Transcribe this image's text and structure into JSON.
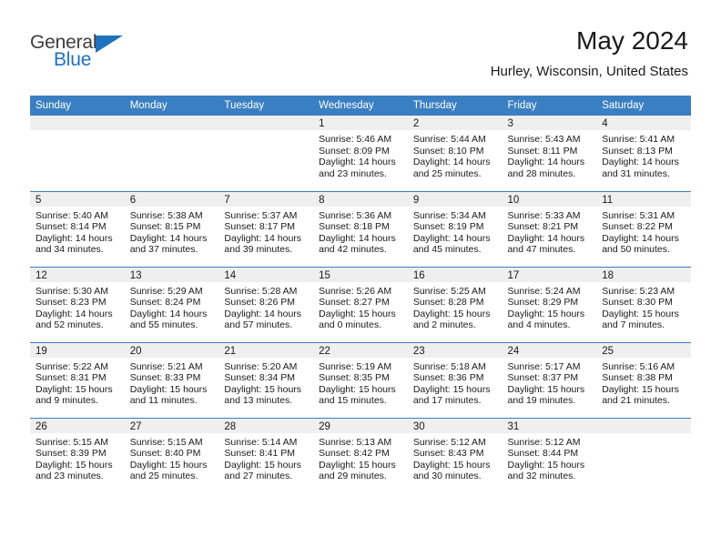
{
  "brand": {
    "name_primary": "General",
    "name_secondary": "Blue",
    "triangle_color": "#1f72bd"
  },
  "header": {
    "title": "May 2024",
    "subtitle": "Hurley, Wisconsin, United States"
  },
  "theme": {
    "header_bar_color": "#3a7fc1",
    "daynum_band_color": "#efefef",
    "row_divider_color": "#3a7fc1",
    "text_color": "#1a1a1a"
  },
  "labels": {
    "sunrise_prefix": "Sunrise:",
    "sunset_prefix": "Sunset:",
    "daylight_prefix": "Daylight:"
  },
  "weekday_headers": [
    "Sunday",
    "Monday",
    "Tuesday",
    "Wednesday",
    "Thursday",
    "Friday",
    "Saturday"
  ],
  "weeks": [
    [
      {
        "day": "",
        "empty": true,
        "line1": "",
        "line2": "",
        "line3": "",
        "line4": ""
      },
      {
        "day": "",
        "empty": true,
        "line1": "",
        "line2": "",
        "line3": "",
        "line4": ""
      },
      {
        "day": "",
        "empty": true,
        "line1": "",
        "line2": "",
        "line3": "",
        "line4": ""
      },
      {
        "day": "1",
        "empty": false,
        "line1": "Sunrise: 5:46 AM",
        "line2": "Sunset: 8:09 PM",
        "line3": "Daylight: 14 hours",
        "line4": "and 23 minutes."
      },
      {
        "day": "2",
        "empty": false,
        "line1": "Sunrise: 5:44 AM",
        "line2": "Sunset: 8:10 PM",
        "line3": "Daylight: 14 hours",
        "line4": "and 25 minutes."
      },
      {
        "day": "3",
        "empty": false,
        "line1": "Sunrise: 5:43 AM",
        "line2": "Sunset: 8:11 PM",
        "line3": "Daylight: 14 hours",
        "line4": "and 28 minutes."
      },
      {
        "day": "4",
        "empty": false,
        "line1": "Sunrise: 5:41 AM",
        "line2": "Sunset: 8:13 PM",
        "line3": "Daylight: 14 hours",
        "line4": "and 31 minutes."
      }
    ],
    [
      {
        "day": "5",
        "empty": false,
        "line1": "Sunrise: 5:40 AM",
        "line2": "Sunset: 8:14 PM",
        "line3": "Daylight: 14 hours",
        "line4": "and 34 minutes."
      },
      {
        "day": "6",
        "empty": false,
        "line1": "Sunrise: 5:38 AM",
        "line2": "Sunset: 8:15 PM",
        "line3": "Daylight: 14 hours",
        "line4": "and 37 minutes."
      },
      {
        "day": "7",
        "empty": false,
        "line1": "Sunrise: 5:37 AM",
        "line2": "Sunset: 8:17 PM",
        "line3": "Daylight: 14 hours",
        "line4": "and 39 minutes."
      },
      {
        "day": "8",
        "empty": false,
        "line1": "Sunrise: 5:36 AM",
        "line2": "Sunset: 8:18 PM",
        "line3": "Daylight: 14 hours",
        "line4": "and 42 minutes."
      },
      {
        "day": "9",
        "empty": false,
        "line1": "Sunrise: 5:34 AM",
        "line2": "Sunset: 8:19 PM",
        "line3": "Daylight: 14 hours",
        "line4": "and 45 minutes."
      },
      {
        "day": "10",
        "empty": false,
        "line1": "Sunrise: 5:33 AM",
        "line2": "Sunset: 8:21 PM",
        "line3": "Daylight: 14 hours",
        "line4": "and 47 minutes."
      },
      {
        "day": "11",
        "empty": false,
        "line1": "Sunrise: 5:31 AM",
        "line2": "Sunset: 8:22 PM",
        "line3": "Daylight: 14 hours",
        "line4": "and 50 minutes."
      }
    ],
    [
      {
        "day": "12",
        "empty": false,
        "line1": "Sunrise: 5:30 AM",
        "line2": "Sunset: 8:23 PM",
        "line3": "Daylight: 14 hours",
        "line4": "and 52 minutes."
      },
      {
        "day": "13",
        "empty": false,
        "line1": "Sunrise: 5:29 AM",
        "line2": "Sunset: 8:24 PM",
        "line3": "Daylight: 14 hours",
        "line4": "and 55 minutes."
      },
      {
        "day": "14",
        "empty": false,
        "line1": "Sunrise: 5:28 AM",
        "line2": "Sunset: 8:26 PM",
        "line3": "Daylight: 14 hours",
        "line4": "and 57 minutes."
      },
      {
        "day": "15",
        "empty": false,
        "line1": "Sunrise: 5:26 AM",
        "line2": "Sunset: 8:27 PM",
        "line3": "Daylight: 15 hours",
        "line4": "and 0 minutes."
      },
      {
        "day": "16",
        "empty": false,
        "line1": "Sunrise: 5:25 AM",
        "line2": "Sunset: 8:28 PM",
        "line3": "Daylight: 15 hours",
        "line4": "and 2 minutes."
      },
      {
        "day": "17",
        "empty": false,
        "line1": "Sunrise: 5:24 AM",
        "line2": "Sunset: 8:29 PM",
        "line3": "Daylight: 15 hours",
        "line4": "and 4 minutes."
      },
      {
        "day": "18",
        "empty": false,
        "line1": "Sunrise: 5:23 AM",
        "line2": "Sunset: 8:30 PM",
        "line3": "Daylight: 15 hours",
        "line4": "and 7 minutes."
      }
    ],
    [
      {
        "day": "19",
        "empty": false,
        "line1": "Sunrise: 5:22 AM",
        "line2": "Sunset: 8:31 PM",
        "line3": "Daylight: 15 hours",
        "line4": "and 9 minutes."
      },
      {
        "day": "20",
        "empty": false,
        "line1": "Sunrise: 5:21 AM",
        "line2": "Sunset: 8:33 PM",
        "line3": "Daylight: 15 hours",
        "line4": "and 11 minutes."
      },
      {
        "day": "21",
        "empty": false,
        "line1": "Sunrise: 5:20 AM",
        "line2": "Sunset: 8:34 PM",
        "line3": "Daylight: 15 hours",
        "line4": "and 13 minutes."
      },
      {
        "day": "22",
        "empty": false,
        "line1": "Sunrise: 5:19 AM",
        "line2": "Sunset: 8:35 PM",
        "line3": "Daylight: 15 hours",
        "line4": "and 15 minutes."
      },
      {
        "day": "23",
        "empty": false,
        "line1": "Sunrise: 5:18 AM",
        "line2": "Sunset: 8:36 PM",
        "line3": "Daylight: 15 hours",
        "line4": "and 17 minutes."
      },
      {
        "day": "24",
        "empty": false,
        "line1": "Sunrise: 5:17 AM",
        "line2": "Sunset: 8:37 PM",
        "line3": "Daylight: 15 hours",
        "line4": "and 19 minutes."
      },
      {
        "day": "25",
        "empty": false,
        "line1": "Sunrise: 5:16 AM",
        "line2": "Sunset: 8:38 PM",
        "line3": "Daylight: 15 hours",
        "line4": "and 21 minutes."
      }
    ],
    [
      {
        "day": "26",
        "empty": false,
        "line1": "Sunrise: 5:15 AM",
        "line2": "Sunset: 8:39 PM",
        "line3": "Daylight: 15 hours",
        "line4": "and 23 minutes."
      },
      {
        "day": "27",
        "empty": false,
        "line1": "Sunrise: 5:15 AM",
        "line2": "Sunset: 8:40 PM",
        "line3": "Daylight: 15 hours",
        "line4": "and 25 minutes."
      },
      {
        "day": "28",
        "empty": false,
        "line1": "Sunrise: 5:14 AM",
        "line2": "Sunset: 8:41 PM",
        "line3": "Daylight: 15 hours",
        "line4": "and 27 minutes."
      },
      {
        "day": "29",
        "empty": false,
        "line1": "Sunrise: 5:13 AM",
        "line2": "Sunset: 8:42 PM",
        "line3": "Daylight: 15 hours",
        "line4": "and 29 minutes."
      },
      {
        "day": "30",
        "empty": false,
        "line1": "Sunrise: 5:12 AM",
        "line2": "Sunset: 8:43 PM",
        "line3": "Daylight: 15 hours",
        "line4": "and 30 minutes."
      },
      {
        "day": "31",
        "empty": false,
        "line1": "Sunrise: 5:12 AM",
        "line2": "Sunset: 8:44 PM",
        "line3": "Daylight: 15 hours",
        "line4": "and 32 minutes."
      },
      {
        "day": "",
        "empty": true,
        "line1": "",
        "line2": "",
        "line3": "",
        "line4": ""
      }
    ]
  ]
}
